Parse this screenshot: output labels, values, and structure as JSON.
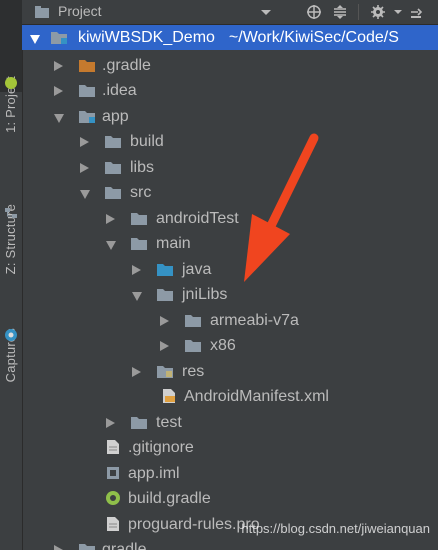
{
  "sidebar": {
    "tabs": [
      {
        "label": "1: Project"
      },
      {
        "label": "Z: Structure"
      },
      {
        "label": "Captures"
      }
    ]
  },
  "header": {
    "title": "Project"
  },
  "tree": {
    "root": {
      "name": "kiwiWBSDK_Demo",
      "path": "~/Work/KiwiSec/Code/S"
    },
    "items": [
      {
        "label": ".gradle"
      },
      {
        "label": ".idea"
      },
      {
        "label": "app"
      },
      {
        "label": "build"
      },
      {
        "label": "libs"
      },
      {
        "label": "src"
      },
      {
        "label": "androidTest"
      },
      {
        "label": "main"
      },
      {
        "label": "java"
      },
      {
        "label": "jniLibs"
      },
      {
        "label": "armeabi-v7a"
      },
      {
        "label": "x86"
      },
      {
        "label": "res"
      },
      {
        "label": "AndroidManifest.xml"
      },
      {
        "label": "test"
      },
      {
        "label": ".gitignore"
      },
      {
        "label": "app.iml"
      },
      {
        "label": "build.gradle"
      },
      {
        "label": "proguard-rules.pro"
      },
      {
        "label": "gradle"
      }
    ]
  },
  "watermark": {
    "text": "https://blog.csdn.net/jiweianquan"
  },
  "colors": {
    "background": "#3c3f41",
    "selection": "#2f65ca",
    "text": "#bbbbbb",
    "folder": "#8d9aa6",
    "source_folder": "#3592c4",
    "gradle_folder": "#c57a2e",
    "arrow_annotation": "#f0451f"
  }
}
